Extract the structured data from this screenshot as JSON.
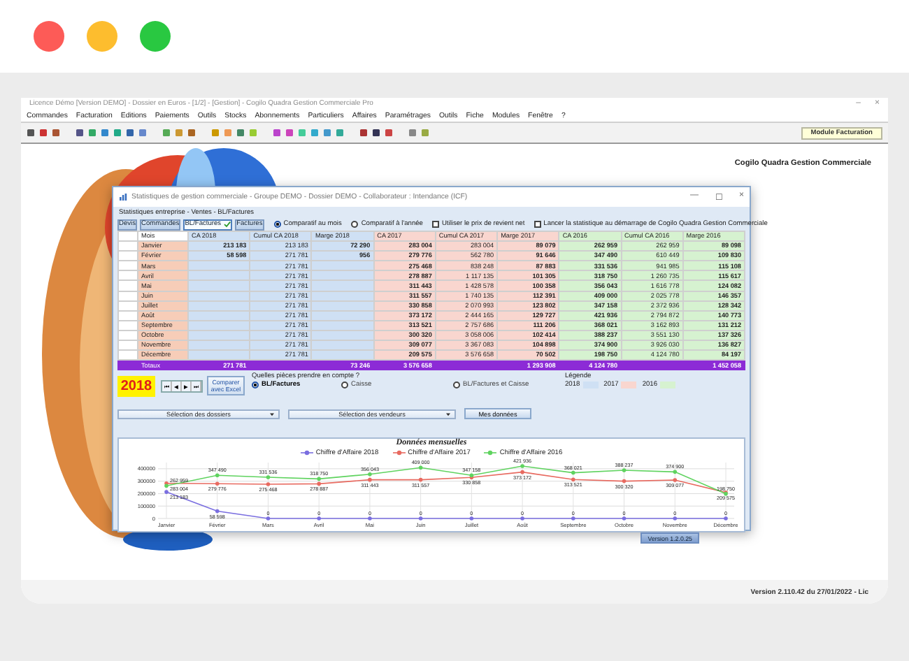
{
  "window": {
    "title": "Licence Démo [Version DEMO] - Dossier en Euros - [1/2] - [Gestion] - Cogilo Quadra Gestion Commerciale Pro",
    "controls": [
      "–",
      "×"
    ],
    "menu": [
      "Commandes",
      "Facturation",
      "Editions",
      "Paiements",
      "Outils",
      "Stocks",
      "Abonnements",
      "Particuliers",
      "Affaires",
      "Paramétrages",
      "Outils",
      "Fiche",
      "Modules",
      "Fenêtre",
      "?"
    ],
    "module_label": "Module Facturation",
    "brand": "Cogilo Quadra Gestion Commerciale"
  },
  "dialog": {
    "title": "Statistiques de gestion commerciale - Groupe DEMO - Dossier DEMO - Collaborateur : Intendance (ICF)",
    "controls": [
      "—",
      "☐",
      "×"
    ],
    "subtitle": "Statistiques entreprise - Ventes - BL/Factures",
    "tabs": [
      {
        "label": "Devis",
        "selected": false
      },
      {
        "label": "Commandes",
        "selected": false
      },
      {
        "label": "BL/Factures",
        "selected": true
      },
      {
        "label": "Factures",
        "selected": false
      }
    ],
    "options": [
      {
        "kind": "radio",
        "label": "Comparatif au mois",
        "checked": true
      },
      {
        "kind": "radio",
        "label": "Comparatif à l'année",
        "checked": false
      },
      {
        "kind": "checkbox",
        "label": "Utiliser le prix de revient net",
        "checked": false
      },
      {
        "kind": "checkbox",
        "label": "Lancer la statistique au démarrage de Cogilo Quadra Gestion Commerciale",
        "checked": false
      }
    ],
    "table": {
      "columns": [
        {
          "label": "Mois"
        },
        {
          "label": "CA 2018",
          "color": "#cfe0f4"
        },
        {
          "label": "Cumul CA 2018",
          "color": "#cfe0f4"
        },
        {
          "label": "Marge 2018",
          "color": "#cfe0f4"
        },
        {
          "label": "CA 2017",
          "color": "#f9d6cf"
        },
        {
          "label": "Cumul CA 2017",
          "color": "#f9d6cf"
        },
        {
          "label": "Marge 2017",
          "color": "#f9d6cf"
        },
        {
          "label": "CA 2016",
          "color": "#d6f2d0"
        },
        {
          "label": "Cumul CA 2016",
          "color": "#d6f2d0"
        },
        {
          "label": "Marge 2016",
          "color": "#d6f2d0"
        }
      ],
      "rows": [
        {
          "cells": [
            "Janvier",
            "213 183",
            "213 183",
            "72 290",
            "283 004",
            "283 004",
            "89 079",
            "262 959",
            "262 959",
            "89 098"
          ]
        },
        {
          "cells": [
            "Février",
            "58 598",
            "271 781",
            "956",
            "279 776",
            "562 780",
            "91 646",
            "347 490",
            "610 449",
            "109 830"
          ]
        },
        {
          "cells": [
            "Mars",
            null,
            "271 781",
            null,
            "275 468",
            "838 248",
            "87 883",
            "331 536",
            "941 985",
            "115 108"
          ]
        },
        {
          "cells": [
            "Avril",
            null,
            "271 781",
            null,
            "278 887",
            "1 117 135",
            "101 305",
            "318 750",
            "1 260 735",
            "115 617"
          ]
        },
        {
          "cells": [
            "Mai",
            null,
            "271 781",
            null,
            "311 443",
            "1 428 578",
            "100 358",
            "356 043",
            "1 616 778",
            "124 082"
          ]
        },
        {
          "cells": [
            "Juin",
            null,
            "271 781",
            null,
            "311 557",
            "1 740 135",
            "112 391",
            "409 000",
            "2 025 778",
            "146 357"
          ]
        },
        {
          "cells": [
            "Juillet",
            null,
            "271 781",
            null,
            "330 858",
            "2 070 993",
            "123 802",
            "347 158",
            "2 372 936",
            "128 342"
          ]
        },
        {
          "cells": [
            "Août",
            null,
            "271 781",
            null,
            "373 172",
            "2 444 165",
            "129 727",
            "421 936",
            "2 794 872",
            "140 773"
          ]
        },
        {
          "cells": [
            "Septembre",
            null,
            "271 781",
            null,
            "313 521",
            "2 757 686",
            "111 206",
            "368 021",
            "3 162 893",
            "131 212"
          ]
        },
        {
          "cells": [
            "Octobre",
            null,
            "271 781",
            null,
            "300 320",
            "3 058 006",
            "102 414",
            "388 237",
            "3 551 130",
            "137 326"
          ]
        },
        {
          "cells": [
            "Novembre",
            null,
            "271 781",
            null,
            "309 077",
            "3 367 083",
            "104 898",
            "374 900",
            "3 926 030",
            "136 827"
          ]
        },
        {
          "cells": [
            "Décembre",
            null,
            "271 781",
            null,
            "209 575",
            "3 576 658",
            "70 502",
            "198 750",
            "4 124 780",
            "84 197"
          ]
        }
      ],
      "totals": {
        "cells": [
          "Totaux",
          "271 781",
          null,
          "73 246",
          "3 576 658",
          null,
          "1 293 908",
          "4 124 780",
          null,
          "1 452 058"
        ]
      }
    },
    "year": "2018",
    "nav_buttons": [
      "⏮",
      "◀",
      "▶",
      "⏭"
    ],
    "compare_button": "Comparer avec Excel",
    "pieces": {
      "label": "Quelles pièces prendre en compte ?",
      "options": [
        {
          "label": "BL/Factures",
          "selected": true
        },
        {
          "label": "Caisse",
          "selected": false
        },
        {
          "label": "BL/Factures et Caisse",
          "selected": false
        }
      ]
    },
    "legend": {
      "label": "Légende",
      "items": [
        {
          "label": "2018",
          "color": "#cfe0f4"
        },
        {
          "label": "2017",
          "color": "#f9d6cf"
        },
        {
          "label": "2016",
          "color": "#d6f2d0"
        }
      ]
    },
    "dropdowns": [
      "Sélection des dossiers",
      "Sélection des vendeurs"
    ],
    "data_button": "Mes données",
    "chart": {
      "chart_data": {
        "type": "line",
        "title": "Données mensuelles",
        "categories": [
          "Janvier",
          "Février",
          "Mars",
          "Avril",
          "Mai",
          "Juin",
          "Juillet",
          "Août",
          "Septembre",
          "Octobre",
          "Novembre",
          "Décembre"
        ],
        "series": [
          {
            "name": "Chiffre d'Affaire 2018",
            "color": "#7a6ee0",
            "values": [
              213183,
              58598,
              0,
              0,
              0,
              0,
              0,
              0,
              0,
              0,
              0,
              0
            ]
          },
          {
            "name": "Chiffre d'Affaire 2017",
            "color": "#e86a60",
            "values": [
              283004,
              279776,
              275468,
              278887,
              311443,
              311557,
              330858,
              373172,
              313521,
              300320,
              309077,
              209575
            ]
          },
          {
            "name": "Chiffre d'Affaire 2016",
            "color": "#5fd35f",
            "values": [
              262959,
              347490,
              331536,
              318750,
              356043,
              409000,
              347158,
              421936,
              368021,
              388237,
              374900,
              198750
            ]
          }
        ],
        "ylim": [
          0,
          450000
        ],
        "yticks": [
          0,
          100000,
          200000,
          300000,
          400000
        ],
        "data_labels": true,
        "grid": true,
        "legend": true
      }
    },
    "version": "Version 1.2.0.25"
  },
  "footer": "Version 2.110.42 du 27/01/2022 - Lic"
}
